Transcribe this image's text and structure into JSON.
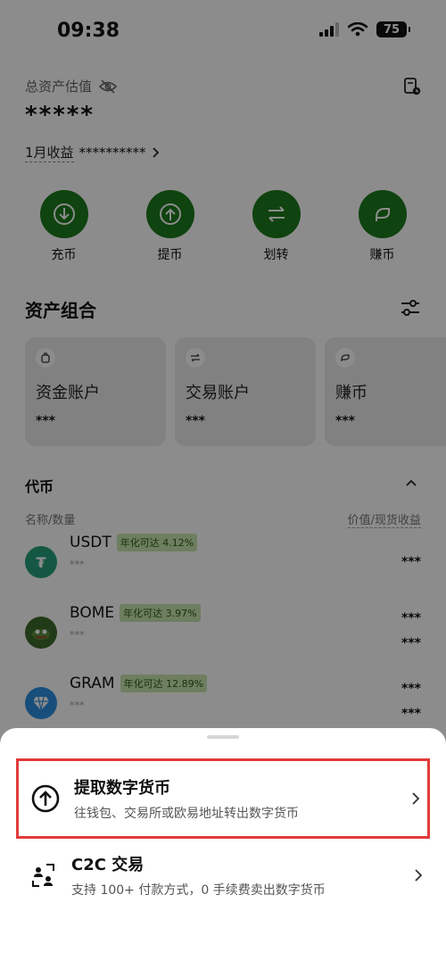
{
  "status_bar": {
    "time": "09:38",
    "battery": "75"
  },
  "assets": {
    "title": "总资产估值",
    "value": "*****",
    "month_label": "1月收益",
    "month_value": "**********"
  },
  "actions": [
    {
      "label": "充币",
      "icon": "deposit-icon"
    },
    {
      "label": "提币",
      "icon": "withdraw-icon"
    },
    {
      "label": "划转",
      "icon": "transfer-icon"
    },
    {
      "label": "赚币",
      "icon": "earn-icon"
    }
  ],
  "portfolio": {
    "title": "资产组合",
    "cards": [
      {
        "name": "资金账户",
        "value": "***",
        "icon": "wallet-icon"
      },
      {
        "name": "交易账户",
        "value": "***",
        "icon": "swap-icon"
      },
      {
        "name": "赚币",
        "value": "***",
        "icon": "leaf-icon"
      }
    ]
  },
  "tokens": {
    "header": "代币",
    "col_left": "名称/数量",
    "col_right": "价值/现货收益",
    "rows": [
      {
        "symbol": "USDT",
        "badge": "年化可达 4.12%",
        "sub": "***",
        "value": "***",
        "pnl": "",
        "color": "#26a17b"
      },
      {
        "symbol": "BOME",
        "badge": "年化可达 3.97%",
        "sub": "***",
        "value": "***",
        "pnl": "***",
        "color": "#3d6b2a"
      },
      {
        "symbol": "GRAM",
        "badge": "年化可达 12.89%",
        "sub": "***",
        "value": "***",
        "pnl": "***",
        "color": "#2d8fe0"
      }
    ]
  },
  "sheet": {
    "options": [
      {
        "title": "提取数字货币",
        "subtitle": "往钱包、交易所或欧易地址转出数字货币",
        "icon": "withdraw-icon"
      },
      {
        "title": "C2C 交易",
        "subtitle": "支持 100+ 付款方式，0 手续费卖出数字货币",
        "icon": "c2c-icon"
      }
    ]
  }
}
